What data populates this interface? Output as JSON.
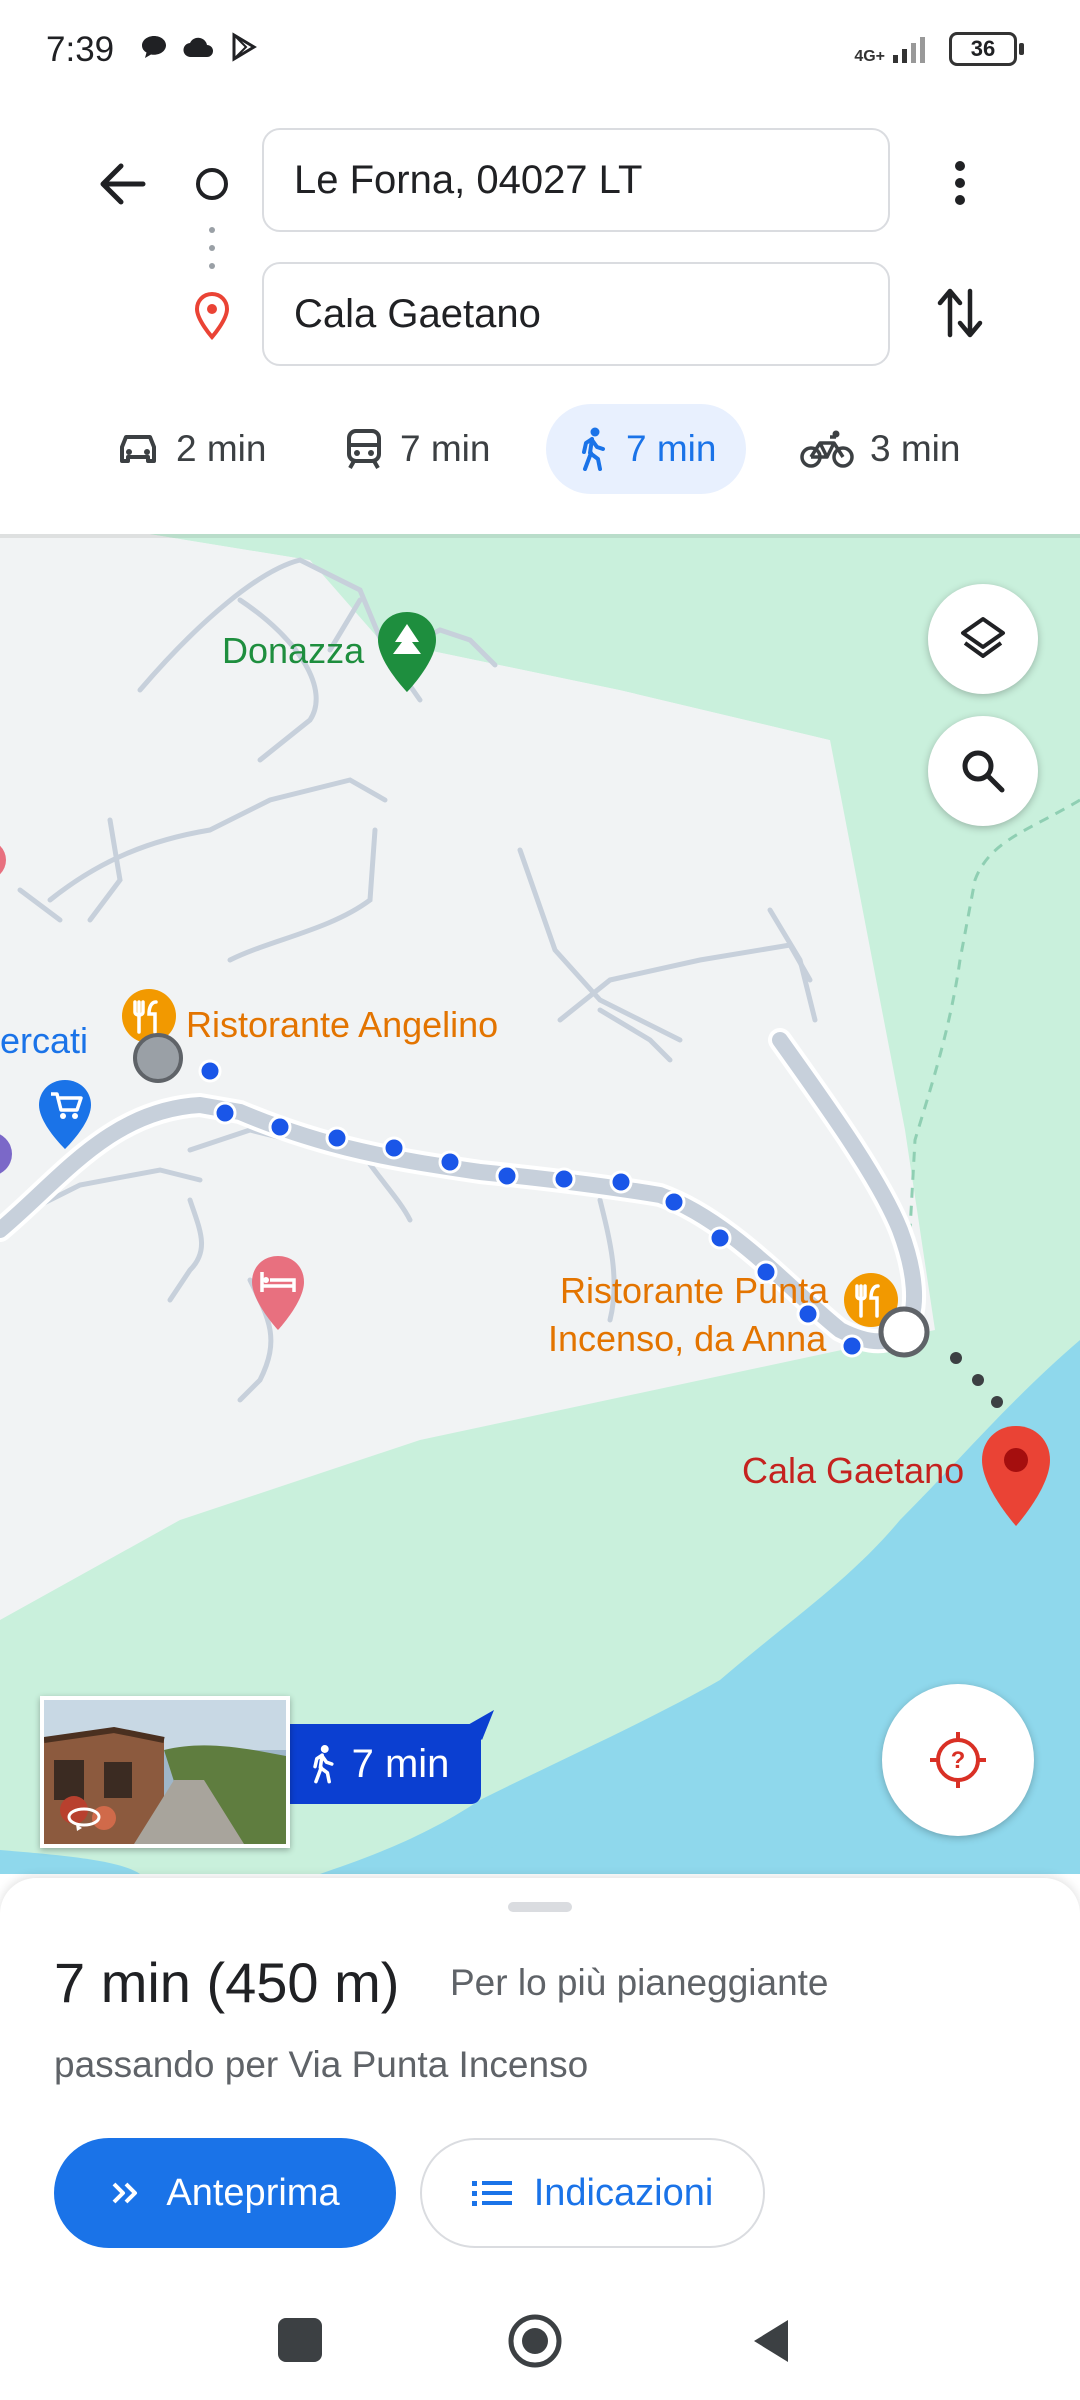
{
  "status_bar": {
    "time": "7:39",
    "network": "4G+",
    "battery": "36"
  },
  "route_search": {
    "origin": "Le Forna, 04027 LT",
    "destination": "Cala Gaetano"
  },
  "travel_modes": [
    {
      "icon": "car-icon",
      "label": "2 min"
    },
    {
      "icon": "transit-icon",
      "label": "7 min"
    },
    {
      "icon": "walk-icon",
      "label": "7 min",
      "selected": true
    },
    {
      "icon": "bike-icon",
      "label": "3 min"
    }
  ],
  "map": {
    "labels": {
      "donazza": "Donazza",
      "angelino": "Ristorante Angelino",
      "mercati": "ercati",
      "punta_incenso_1": "Ristorante Punta",
      "punta_incenso_2": "Incenso, da Anna",
      "destination": "Cala Gaetano"
    },
    "route_badge": "7 min",
    "colors": {
      "land": "#c9f0dc",
      "built_area": "#f1f3f4",
      "water": "#8fd8ec",
      "route": "#1a56e8",
      "restaurant_pin": "#f29900",
      "destination_pin": "#ea4335",
      "park_pin": "#1e8e3e",
      "hotel_pin": "#e8707f"
    }
  },
  "sheet": {
    "duration": "7 min (450 m)",
    "summary": "Per lo più pianeggiante",
    "via": "passando per Via Punta Incenso",
    "preview_button": "Anteprima",
    "directions_button": "Indicazioni"
  }
}
